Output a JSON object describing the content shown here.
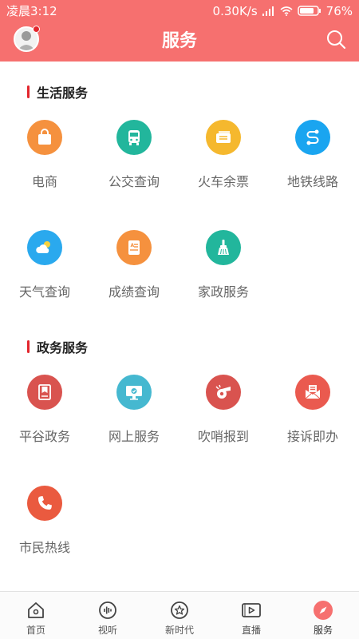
{
  "status_bar": {
    "time": "凌晨3:12",
    "speed": "0.30K/s",
    "battery": "76%"
  },
  "header": {
    "title": "服务"
  },
  "sections": [
    {
      "title": "生活服务",
      "items": [
        {
          "label": "电商",
          "icon": "shopping-bag-icon",
          "color": "#f5913e"
        },
        {
          "label": "公交查询",
          "icon": "bus-icon",
          "color": "#22b69c"
        },
        {
          "label": "火车余票",
          "icon": "ticket-icon",
          "color": "#f5b82e"
        },
        {
          "label": "地铁线路",
          "icon": "metro-route-icon",
          "color": "#1aa5f0"
        },
        {
          "label": "天气查询",
          "icon": "weather-icon",
          "color": "#2aa9ee"
        },
        {
          "label": "成绩查询",
          "icon": "grade-report-icon",
          "color": "#f5913e"
        },
        {
          "label": "家政服务",
          "icon": "broom-icon",
          "color": "#22b69c"
        }
      ]
    },
    {
      "title": "政务服务",
      "items": [
        {
          "label": "平谷政务",
          "icon": "gov-badge-icon",
          "color": "#d9534f"
        },
        {
          "label": "网上服务",
          "icon": "monitor-check-icon",
          "color": "#45b8d0"
        },
        {
          "label": "吹哨报到",
          "icon": "whistle-icon",
          "color": "#d9534f"
        },
        {
          "label": "接诉即办",
          "icon": "mail-icon",
          "color": "#ea5a4f"
        },
        {
          "label": "市民热线",
          "icon": "phone-icon",
          "color": "#ea5a3f"
        }
      ]
    }
  ],
  "tabbar": {
    "items": [
      {
        "label": "首页",
        "icon": "home-icon"
      },
      {
        "label": "视听",
        "icon": "audio-wave-icon"
      },
      {
        "label": "新时代",
        "icon": "star-circle-icon"
      },
      {
        "label": "直播",
        "icon": "live-video-icon"
      },
      {
        "label": "服务",
        "icon": "compass-icon",
        "active": true
      }
    ],
    "active_color": "#f6706f"
  }
}
